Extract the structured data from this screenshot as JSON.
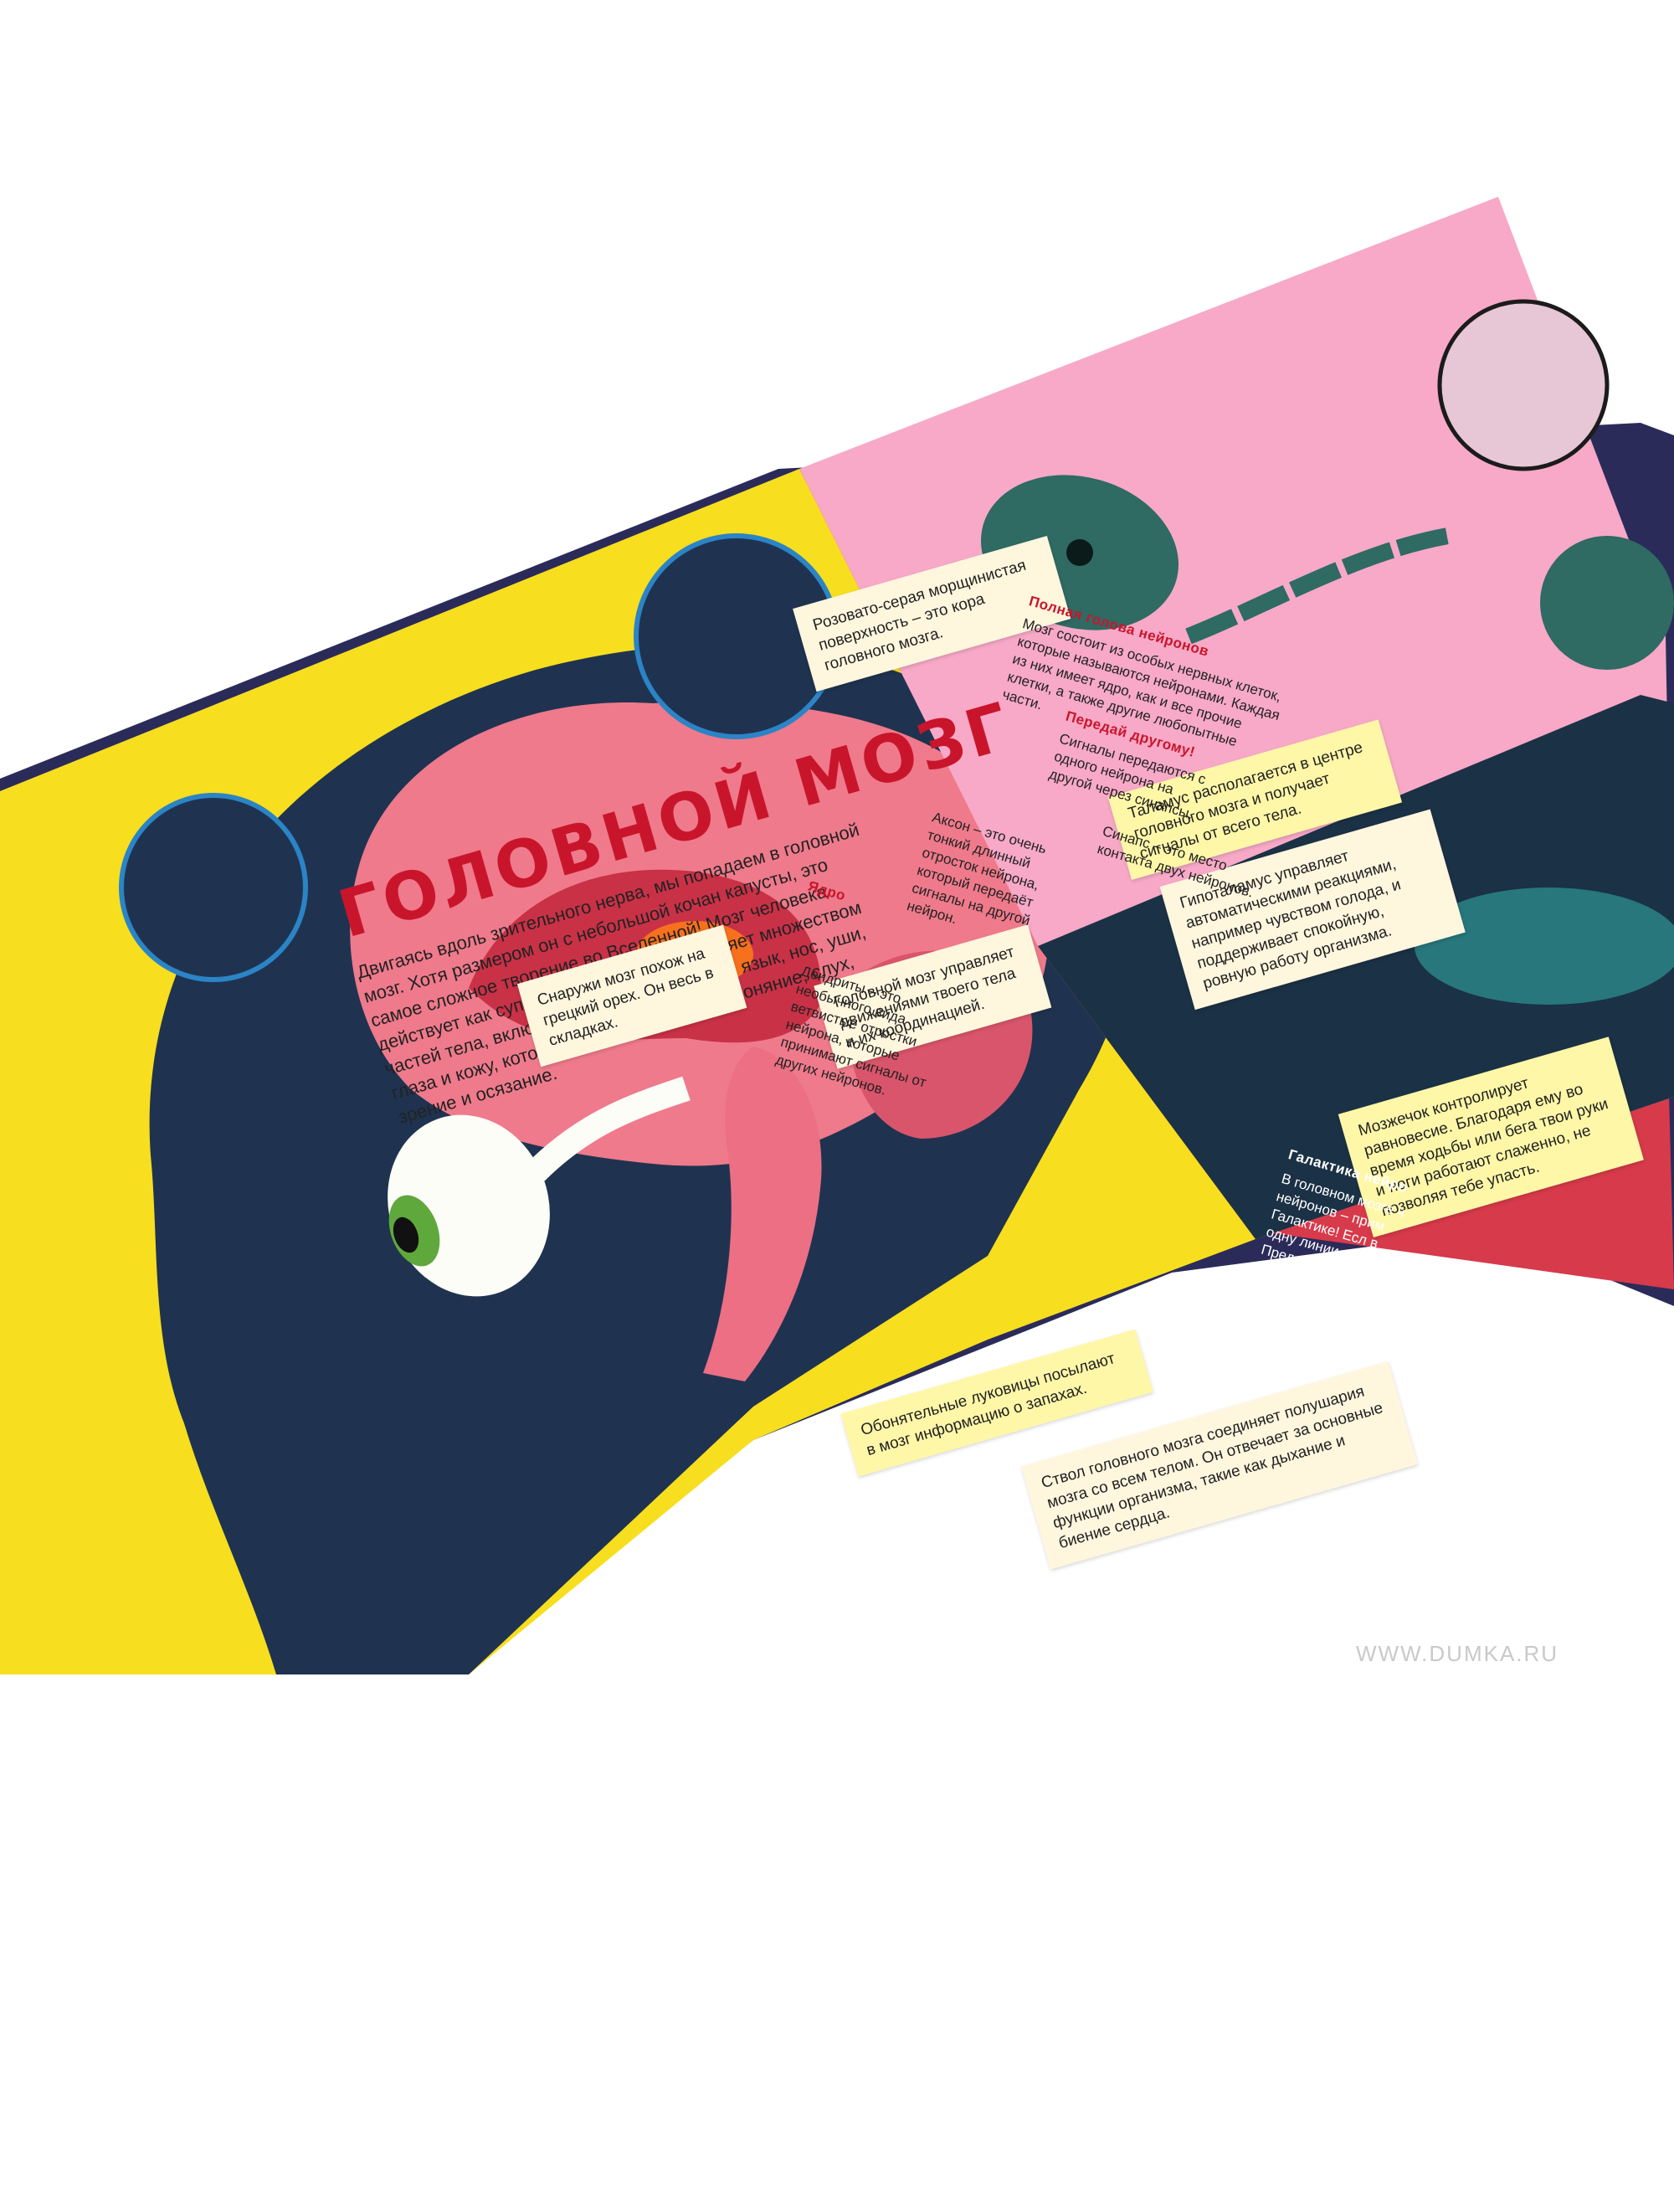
{
  "left_page": {
    "title": "Головной мозг",
    "intro": "Двигаясь вдоль зрительного нерва, мы попадаем в головной мозг. Хотя размером он с небольшой кочан капусты, это самое сложное творение во Вселенной! Мозг человека действует как суперкомпьютер. Он управляет множеством частей тела, включая пять органов чувств: язык, нос, уши, глаза и кожу, которые отвечают за вкус, обоняние, слух, зрение и осязание.",
    "callouts": {
      "cortex": "Розовато-серая морщинистая поверхность – это кора головного мозга.",
      "walnut": "Снаружи мозг похож на грецкий орех. Он весь в складках.",
      "cerebrum": "Головной мозг управляет движениями твоего тела и их координацией.",
      "thalamus": "Таламус располагается в центре головного мозга и получает сигналы от всего тела.",
      "hypothalamus": "Гипоталамус управляет автоматическими реакциями, например чувством голода, и поддерживает спокойную, ровную работу организма.",
      "cerebellum": "Мозжечок контролирует равновесие. Благодаря ему во время ходьбы или бега твои руки и ноги работают слаженно, не позволяя тебе упасть.",
      "olfactory": "Обонятельные луковицы посылают в мозг информацию о запахах.",
      "brainstem": "Ствол головного мозга соединяет полушария мозга со всем телом. Он отвечает за основные функции организма, такие как дыхание и биение сердца."
    }
  },
  "right_page": {
    "neurons_title": "Полная голова нейронов",
    "neurons_text": "Мозг состоит из особых нервных клеток, которые называются нейронами. Каждая из них имеет ядро, как и все прочие клетки, а также другие любопытные части.",
    "pass_title": "Передай другому!",
    "pass_text": "Сигналы передаются с одного нейрона на другой через синапсы.",
    "synapse": "Синапс – это место контакта двух нейронов.",
    "axon": "Аксон – это очень тонкий длинный отросток нейрона, который передаёт сигналы на другой нейрон.",
    "nucleus": "Ядро",
    "dendrites": "Дендриты – это необычного вида ветвистые отростки нейрона, которые принимают сигналы от других нейронов.",
    "galaxy_title": "Галактика нейро",
    "galaxy_text": "В головном мозге ч нейронов – прим Галактике! Есл в одну линии Представ"
  },
  "watermark": "WWW.DUMKA.RU",
  "colors": {
    "yellow": "#f7de1e",
    "navy": "#1f3350",
    "brain": "#ef7a8b",
    "pink": "#f7a9c7",
    "teal": "#2f6a63",
    "red": "#c9152b"
  }
}
